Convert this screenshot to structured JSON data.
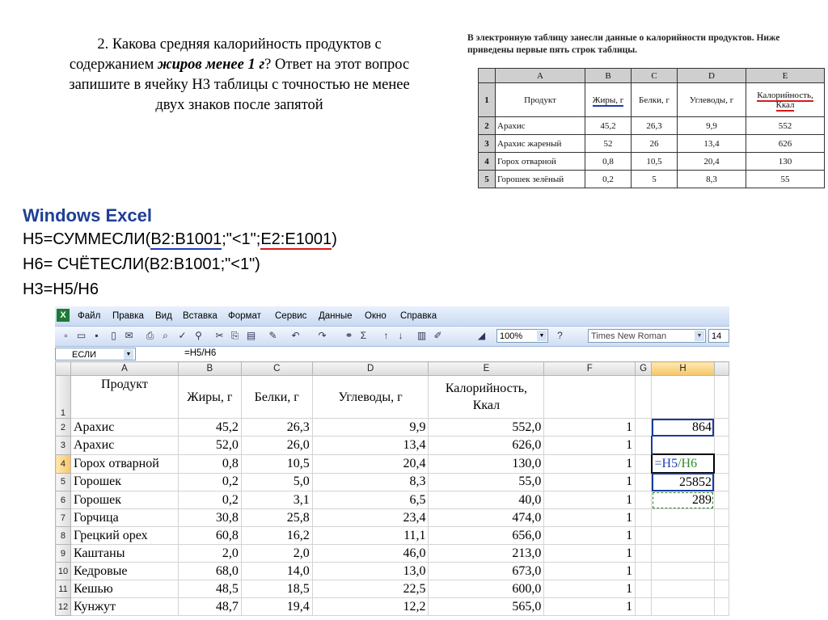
{
  "question": {
    "line1": "2. Какова средняя калорийность продуктов с",
    "line2_pre": "содержанием ",
    "line2_bold": "жиров менее 1 г",
    "line2_post": "? Ответ на этот вопрос",
    "line3": "запишите в ячейку H3 таблицы с точностью не менее",
    "line4": "двух знаков после запятой"
  },
  "scan": {
    "intro1": "В электронную таблицу занесли данные о калорийности продуктов. Ниже",
    "intro2": "приведены первые пять строк таблицы.",
    "cols": [
      "A",
      "B",
      "C",
      "D",
      "E"
    ],
    "headers": [
      "Продукт",
      "Жиры, г",
      "Белки, г",
      "Углеводы, г",
      "Калорийность, Ккал"
    ],
    "rows": [
      {
        "n": "2",
        "cells": [
          "Арахис",
          "45,2",
          "26,3",
          "9,9",
          "552"
        ]
      },
      {
        "n": "3",
        "cells": [
          "Арахис жареный",
          "52",
          "26",
          "13,4",
          "626"
        ]
      },
      {
        "n": "4",
        "cells": [
          "Горох отварной",
          "0,8",
          "10,5",
          "20,4",
          "130"
        ]
      },
      {
        "n": "5",
        "cells": [
          "Горошек зелёный",
          "0,2",
          "5",
          "8,3",
          "55"
        ]
      }
    ]
  },
  "excel_title": "Windows Excel",
  "formulas": {
    "h5_pre": "H5=СУММЕСЛИ(",
    "h5_range1": "B2:B1001",
    "h5_mid": ";\"<1\";",
    "h5_range2": "E2:E1001",
    "h5_post": ")",
    "h6": "H6= СЧЁТЕСЛИ(B2:B1001;\"<1\")",
    "h3": "H3=H5/H6"
  },
  "excel": {
    "menu": [
      "Файл",
      "Правка",
      "Вид",
      "Вставка",
      "Формат",
      "Сервис",
      "Данные",
      "Окно",
      "Справка"
    ],
    "zoom": "100%",
    "font": "Times New Roman",
    "font_size": "14",
    "name_box": "ЕСЛИ",
    "formula_bar": "=H5/H6",
    "columns": [
      "A",
      "B",
      "C",
      "D",
      "E",
      "F",
      "G",
      "H"
    ],
    "headers": [
      "Продукт",
      "Жиры, г",
      "Белки, г",
      "Углеводы, г",
      "Калорийность, Ккал"
    ],
    "rows": [
      {
        "n": "2",
        "a": "Арахис",
        "b": "45,2",
        "c": "26,3",
        "d": "9,9",
        "e": "552,0",
        "f": "1",
        "h": "864"
      },
      {
        "n": "3",
        "a": "Арахис",
        "b": "52,0",
        "c": "26,0",
        "d": "13,4",
        "e": "626,0",
        "f": "1",
        "h": ""
      },
      {
        "n": "4",
        "a": "Горох отварной",
        "b": "0,8",
        "c": "10,5",
        "d": "20,4",
        "e": "130,0",
        "f": "1",
        "h": ""
      },
      {
        "n": "5",
        "a": "Горошек",
        "b": "0,2",
        "c": "5,0",
        "d": "8,3",
        "e": "55,0",
        "f": "1",
        "h": "25852"
      },
      {
        "n": "6",
        "a": "Горошек",
        "b": "0,2",
        "c": "3,1",
        "d": "6,5",
        "e": "40,0",
        "f": "1",
        "h": "289"
      },
      {
        "n": "7",
        "a": "Горчица",
        "b": "30,8",
        "c": "25,8",
        "d": "23,4",
        "e": "474,0",
        "f": "1",
        "h": ""
      },
      {
        "n": "8",
        "a": "Грецкий орех",
        "b": "60,8",
        "c": "16,2",
        "d": "11,1",
        "e": "656,0",
        "f": "1",
        "h": ""
      },
      {
        "n": "9",
        "a": "Каштаны",
        "b": "2,0",
        "c": "2,0",
        "d": "46,0",
        "e": "213,0",
        "f": "1",
        "h": ""
      },
      {
        "n": "10",
        "a": "Кедровые",
        "b": "68,0",
        "c": "14,0",
        "d": "13,0",
        "e": "673,0",
        "f": "1",
        "h": ""
      },
      {
        "n": "11",
        "a": "Кешью",
        "b": "48,5",
        "c": "18,5",
        "d": "22,5",
        "e": "600,0",
        "f": "1",
        "h": ""
      },
      {
        "n": "12",
        "a": "Кунжут",
        "b": "48,7",
        "c": "19,4",
        "d": "12,2",
        "e": "565,0",
        "f": "1",
        "h": ""
      }
    ],
    "h4_formula_a": "=H5",
    "h4_formula_b": "/H6"
  }
}
